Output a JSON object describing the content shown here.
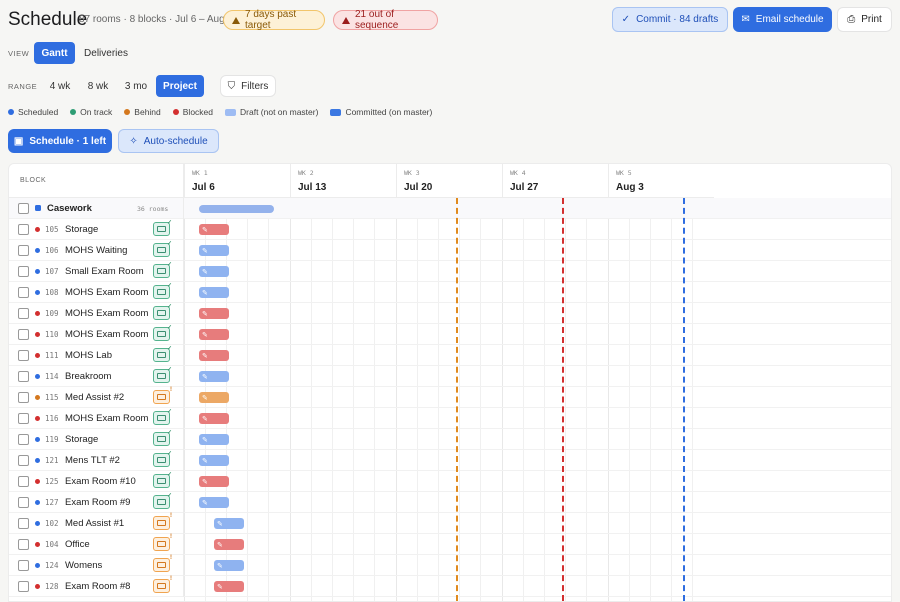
{
  "header": {
    "title": "Schedule",
    "meta": "87 rooms · 8 blocks · Jul 6 – Aug 9",
    "warn_pill": "7 days past target",
    "err_pill": "21 out of sequence",
    "commit_label": "Commit · 84 drafts",
    "email_label": "Email schedule",
    "print_label": "Print"
  },
  "view": {
    "label": "VIEW",
    "options": [
      "Gantt",
      "Deliveries"
    ],
    "selected": "Gantt"
  },
  "range": {
    "label": "RANGE",
    "options": [
      "4 wk",
      "8 wk",
      "3 mo",
      "Project"
    ],
    "selected": "Project",
    "filters_label": "Filters"
  },
  "legend": [
    {
      "label": "Scheduled",
      "kind": "dot",
      "color": "#2f6de0"
    },
    {
      "label": "On track",
      "kind": "dot",
      "color": "#2e9d74"
    },
    {
      "label": "Behind",
      "kind": "dot",
      "color": "#d4781e"
    },
    {
      "label": "Blocked",
      "kind": "dot",
      "color": "#d32f2f"
    },
    {
      "label": "Draft (not on master)",
      "kind": "swatch",
      "color": "#9ebcf3"
    },
    {
      "label": "Committed (on master)",
      "kind": "swatch",
      "color": "#3b78e2"
    }
  ],
  "actions": {
    "schedule_label": "Schedule · 1 left",
    "auto_label": "Auto-schedule"
  },
  "grid": {
    "block_header": "BLOCK",
    "weeks": [
      {
        "num": "WK 1",
        "date": "Jul 6"
      },
      {
        "num": "WK 2",
        "date": "Jul 13"
      },
      {
        "num": "WK 3",
        "date": "Jul 20"
      },
      {
        "num": "WK 4",
        "date": "Jul 27"
      },
      {
        "num": "WK 5",
        "date": "Aug 3"
      }
    ],
    "group": {
      "name": "Casework",
      "count": "36 rooms"
    },
    "rows": [
      {
        "code": "105",
        "name": "Storage",
        "status": "blocked",
        "truck": "ok",
        "bar": "red",
        "start": 0
      },
      {
        "code": "106",
        "name": "MOHS Waiting",
        "status": "scheduled",
        "truck": "ok",
        "bar": "blue",
        "start": 0
      },
      {
        "code": "107",
        "name": "Small Exam Room",
        "status": "scheduled",
        "truck": "ok",
        "bar": "blue",
        "start": 0
      },
      {
        "code": "108",
        "name": "MOHS Exam Room",
        "status": "scheduled",
        "truck": "ok",
        "bar": "blue",
        "start": 0
      },
      {
        "code": "109",
        "name": "MOHS Exam Room",
        "status": "blocked",
        "truck": "ok",
        "bar": "red",
        "start": 0
      },
      {
        "code": "110",
        "name": "MOHS Exam Room",
        "status": "blocked",
        "truck": "ok",
        "bar": "red",
        "start": 0
      },
      {
        "code": "111",
        "name": "MOHS Lab",
        "status": "blocked",
        "truck": "ok",
        "bar": "red",
        "start": 0
      },
      {
        "code": "114",
        "name": "Breakroom",
        "status": "scheduled",
        "truck": "ok",
        "bar": "blue",
        "start": 0
      },
      {
        "code": "115",
        "name": "Med Assist #2",
        "status": "behind",
        "truck": "warn",
        "bar": "orange",
        "start": 0
      },
      {
        "code": "116",
        "name": "MOHS Exam Room",
        "status": "blocked",
        "truck": "ok",
        "bar": "red",
        "start": 0
      },
      {
        "code": "119",
        "name": "Storage",
        "status": "scheduled",
        "truck": "ok",
        "bar": "blue",
        "start": 0
      },
      {
        "code": "121",
        "name": "Mens TLT #2",
        "status": "scheduled",
        "truck": "ok",
        "bar": "blue",
        "start": 0
      },
      {
        "code": "125",
        "name": "Exam Room #10",
        "status": "blocked",
        "truck": "ok",
        "bar": "red",
        "start": 0
      },
      {
        "code": "127",
        "name": "Exam Room #9",
        "status": "scheduled",
        "truck": "ok",
        "bar": "blue",
        "start": 0
      },
      {
        "code": "102",
        "name": "Med Assist #1",
        "status": "scheduled",
        "truck": "warn",
        "bar": "blue",
        "start": 1
      },
      {
        "code": "104",
        "name": "Office",
        "status": "blocked",
        "truck": "warn",
        "bar": "red",
        "start": 1
      },
      {
        "code": "124",
        "name": "Womens",
        "status": "scheduled",
        "truck": "warn",
        "bar": "blue",
        "start": 1
      },
      {
        "code": "128",
        "name": "Exam Room #8",
        "status": "blocked",
        "truck": "warn",
        "bar": "red",
        "start": 1
      }
    ]
  },
  "colors": {
    "scheduled": "#2f6de0",
    "on_track": "#2e9d74",
    "behind": "#d4781e",
    "blocked": "#d32f2f",
    "bar_blue": "#8fb3f0",
    "bar_red": "#e77c7c",
    "bar_orange": "#eca865",
    "bar_group": "#94b2ec",
    "marker_orange": "#e08a1e",
    "marker_red": "#d32f2f",
    "marker_blue": "#2f6de0"
  }
}
